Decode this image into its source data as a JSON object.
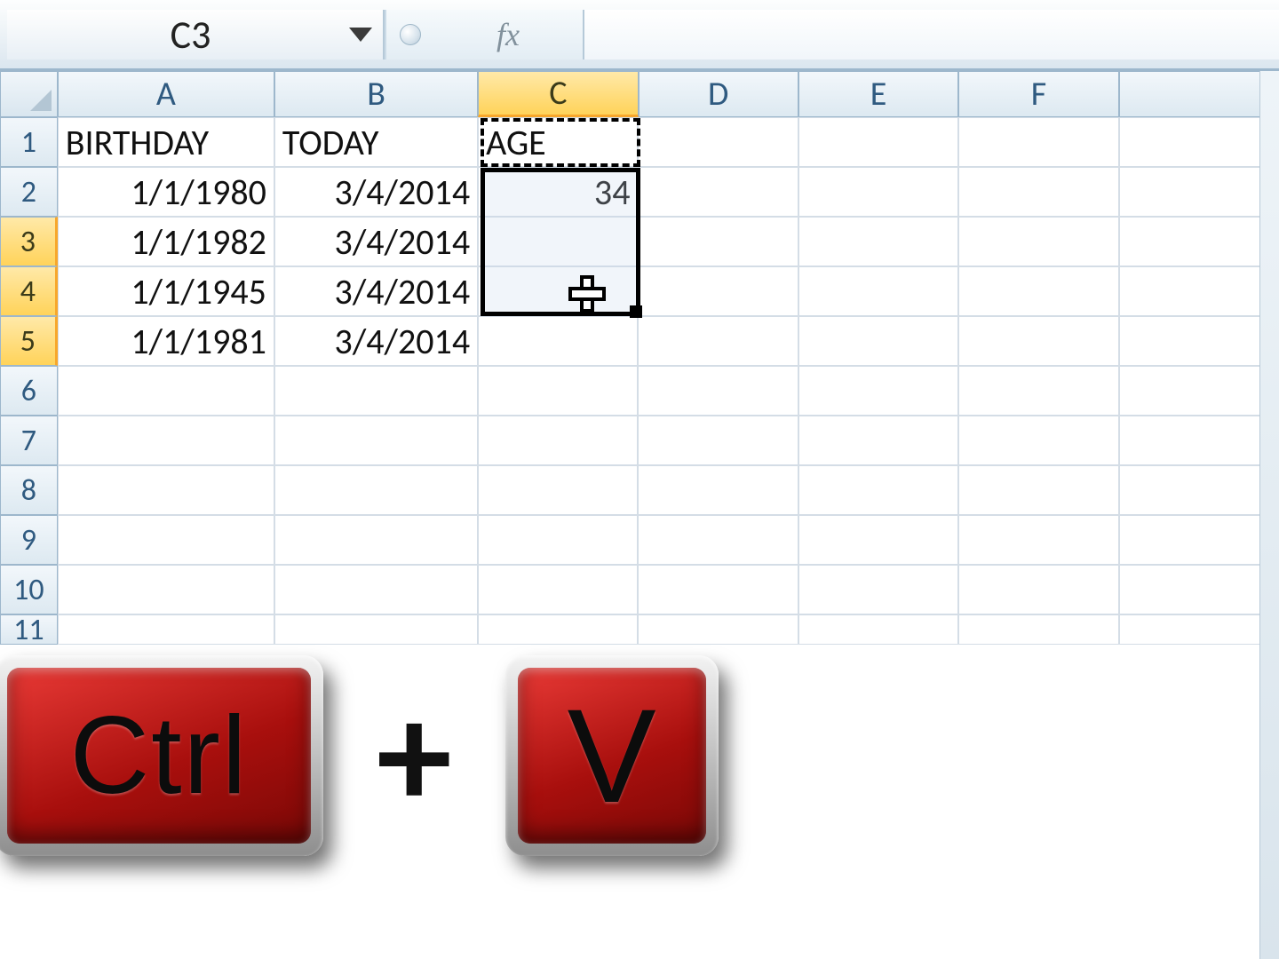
{
  "formula_bar": {
    "cell_ref": "C3",
    "fx_label": "fx",
    "formula": ""
  },
  "columns": [
    "A",
    "B",
    "C",
    "D",
    "E",
    "F"
  ],
  "active_column": "C",
  "rows": {
    "1": {
      "A": "BIRTHDAY",
      "B": "TODAY",
      "C": "AGE"
    },
    "2": {
      "A": "1/1/1980",
      "B": "3/4/2014",
      "C": "34"
    },
    "3": {
      "A": "1/1/1982",
      "B": "3/4/2014",
      "C": ""
    },
    "4": {
      "A": "1/1/1945",
      "B": "3/4/2014",
      "C": ""
    },
    "5": {
      "A": "1/1/1981",
      "B": "3/4/2014",
      "C": ""
    }
  },
  "row_count": 11,
  "active_rows": [
    3,
    4,
    5
  ],
  "copy_source_cell": "C2",
  "selection_range": "C3:C5",
  "shortcut": {
    "key1": "Ctrl",
    "plus": "+",
    "key2": "V"
  }
}
